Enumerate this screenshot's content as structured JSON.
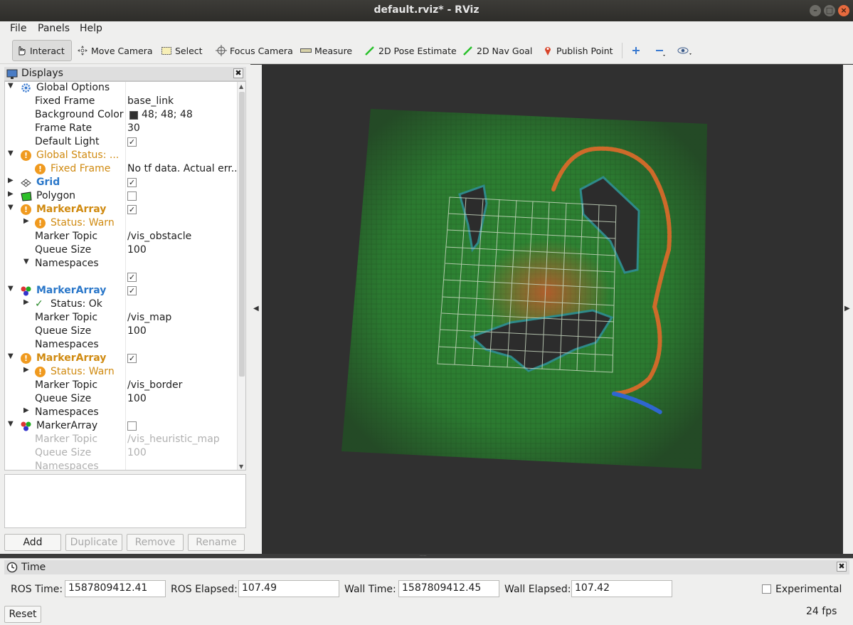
{
  "window": {
    "title": "default.rviz* - RViz"
  },
  "menu": {
    "file": "File",
    "panels": "Panels",
    "help": "Help"
  },
  "toolbar": {
    "interact": "Interact",
    "move_camera": "Move Camera",
    "select": "Select",
    "focus_camera": "Focus Camera",
    "measure": "Measure",
    "pose_estimate": "2D Pose Estimate",
    "nav_goal": "2D Nav Goal",
    "publish_point": "Publish Point"
  },
  "displays": {
    "title": "Displays",
    "rows": [
      {
        "label": "Global Options",
        "value": ""
      },
      {
        "label": "Fixed Frame",
        "value": "base_link"
      },
      {
        "label": "Background Color",
        "value": "48; 48; 48"
      },
      {
        "label": "Frame Rate",
        "value": "30"
      },
      {
        "label": "Default Light",
        "value": ""
      },
      {
        "label": "Global Status: ...",
        "value": ""
      },
      {
        "label": "Fixed Frame",
        "value": "No tf data.  Actual err..."
      },
      {
        "label": "Grid",
        "value": ""
      },
      {
        "label": "Polygon",
        "value": ""
      },
      {
        "label": "MarkerArray",
        "value": ""
      },
      {
        "label": "Status: Warn",
        "value": ""
      },
      {
        "label": "Marker Topic",
        "value": "/vis_obstacle"
      },
      {
        "label": "Queue Size",
        "value": "100"
      },
      {
        "label": "Namespaces",
        "value": ""
      },
      {
        "label": "",
        "value": ""
      },
      {
        "label": "MarkerArray",
        "value": ""
      },
      {
        "label": "Status: Ok",
        "value": ""
      },
      {
        "label": "Marker Topic",
        "value": "/vis_map"
      },
      {
        "label": "Queue Size",
        "value": "100"
      },
      {
        "label": "Namespaces",
        "value": ""
      },
      {
        "label": "MarkerArray",
        "value": ""
      },
      {
        "label": "Status: Warn",
        "value": ""
      },
      {
        "label": "Marker Topic",
        "value": "/vis_border"
      },
      {
        "label": "Queue Size",
        "value": "100"
      },
      {
        "label": "Namespaces",
        "value": ""
      },
      {
        "label": "MarkerArray",
        "value": ""
      },
      {
        "label": "Marker Topic",
        "value": "/vis_heuristic_map"
      },
      {
        "label": "Queue Size",
        "value": "100"
      },
      {
        "label": "Namespaces",
        "value": ""
      }
    ],
    "buttons": {
      "add": "Add",
      "duplicate": "Duplicate",
      "remove": "Remove",
      "rename": "Rename"
    }
  },
  "time": {
    "title": "Time",
    "ros_time_label": "ROS Time:",
    "ros_time": "1587809412.41",
    "ros_elapsed_label": "ROS Elapsed:",
    "ros_elapsed": "107.49",
    "wall_time_label": "Wall Time:",
    "wall_time": "1587809412.45",
    "wall_elapsed_label": "Wall Elapsed:",
    "wall_elapsed": "107.42",
    "experimental": "Experimental",
    "reset": "Reset",
    "fps": "24 fps"
  },
  "colors": {
    "background": "#303030",
    "map_green": "#2f8f36",
    "obstacle": "#2c2c2c",
    "path_orange": "#e06a2a",
    "path_blue": "#2f66d0",
    "warn": "#d08a10"
  }
}
